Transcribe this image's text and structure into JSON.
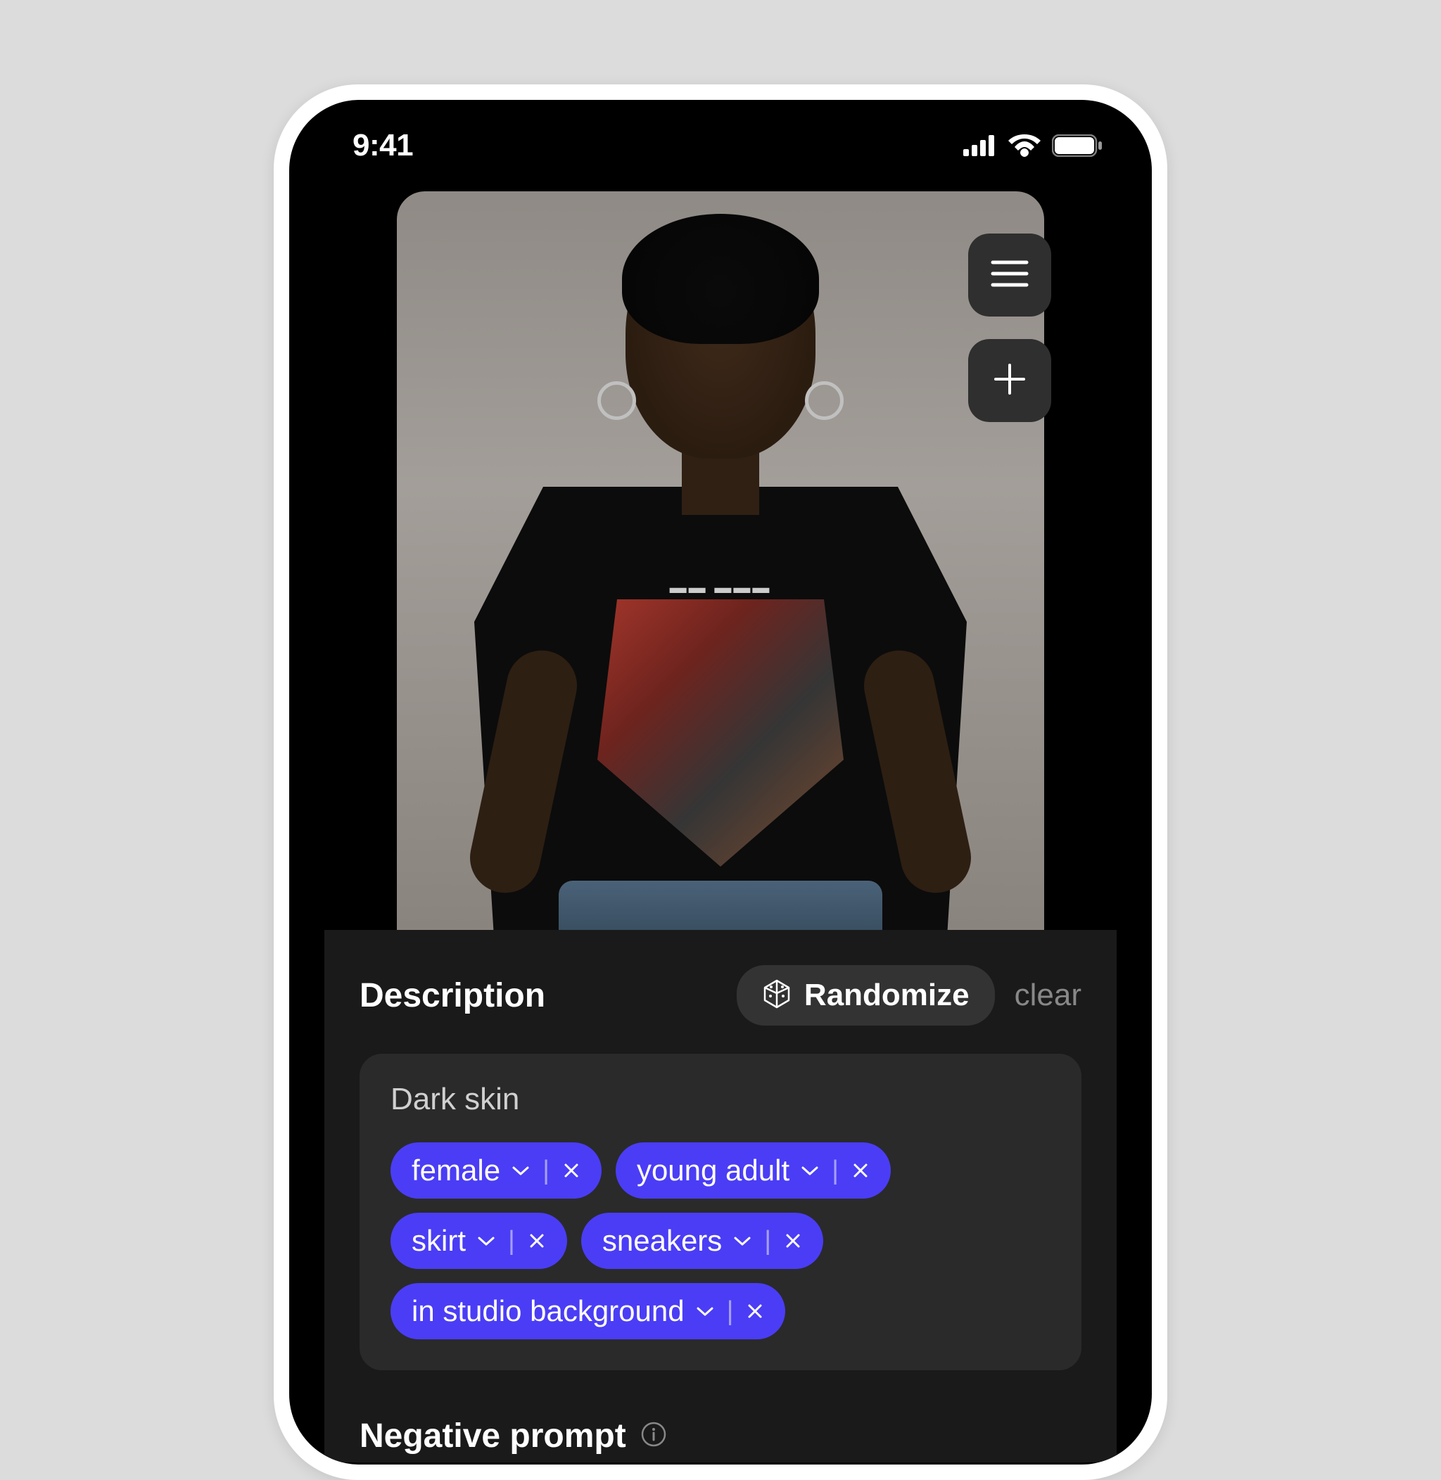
{
  "status": {
    "time": "9:41"
  },
  "panel": {
    "description_heading": "Description",
    "randomize_label": "Randomize",
    "clear_label": "clear",
    "description_text": "Dark skin",
    "tags": [
      {
        "label": "female"
      },
      {
        "label": "young adult"
      },
      {
        "label": "skirt"
      },
      {
        "label": "sneakers"
      },
      {
        "label": "in studio background"
      }
    ],
    "negative_heading": "Negative prompt"
  }
}
